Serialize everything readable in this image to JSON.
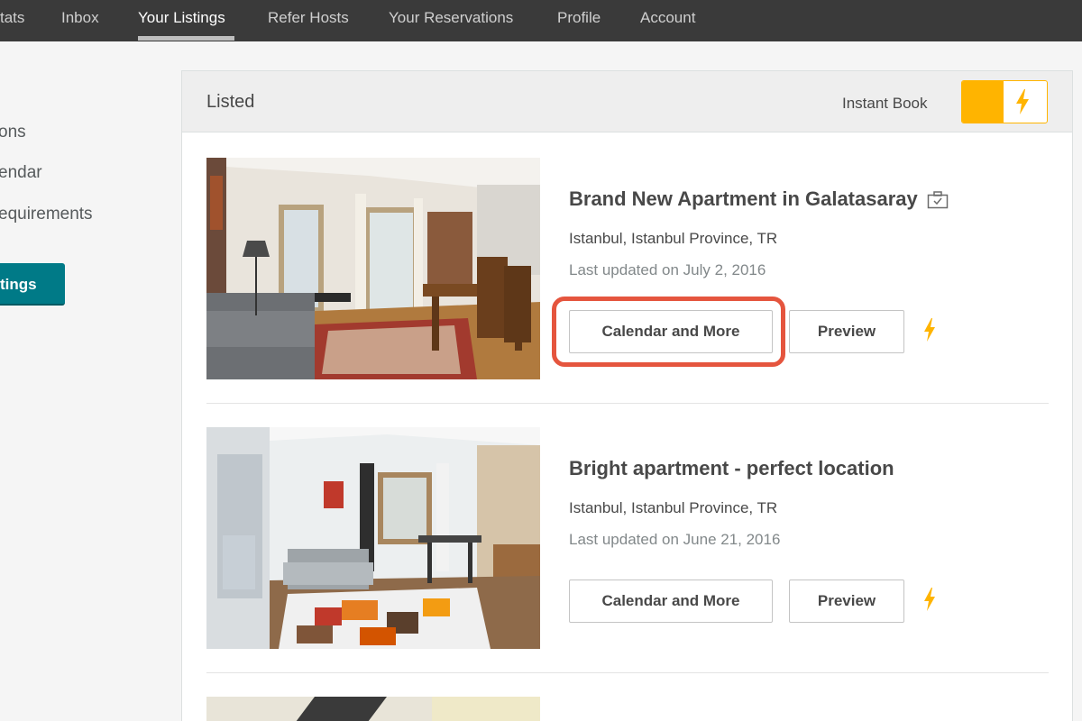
{
  "nav": {
    "items": [
      {
        "label": "tats",
        "active": false
      },
      {
        "label": "Inbox",
        "active": false
      },
      {
        "label": "Your Listings",
        "active": true
      },
      {
        "label": "Refer Hosts",
        "active": false
      },
      {
        "label": "Your Reservations",
        "active": false
      },
      {
        "label": "Profile",
        "active": false
      },
      {
        "label": "Account",
        "active": false
      }
    ]
  },
  "sidebar": {
    "items": [
      {
        "label": "ons"
      },
      {
        "label": "endar"
      },
      {
        "label": "equirements"
      }
    ],
    "button_label": "tings"
  },
  "panel": {
    "title": "Listed",
    "instant_book_label": "Instant Book",
    "instant_book_on": true
  },
  "listings": [
    {
      "title": "Brand New Apartment in Galatasaray",
      "location": "Istanbul, Istanbul Province, TR",
      "updated": "Last updated on July 2, 2016",
      "calendar_label": "Calendar and More",
      "preview_label": "Preview",
      "has_title_icon": true
    },
    {
      "title": "Bright apartment - perfect location",
      "location": "Istanbul, Istanbul Province, TR",
      "updated": "Last updated on June 21, 2016",
      "calendar_label": "Calendar and More",
      "preview_label": "Preview",
      "has_title_icon": false
    }
  ],
  "colors": {
    "nav_bg": "#3a3a3a",
    "accent_teal": "#007a87",
    "instant_book": "#ffb400",
    "highlight": "#e5553e"
  }
}
